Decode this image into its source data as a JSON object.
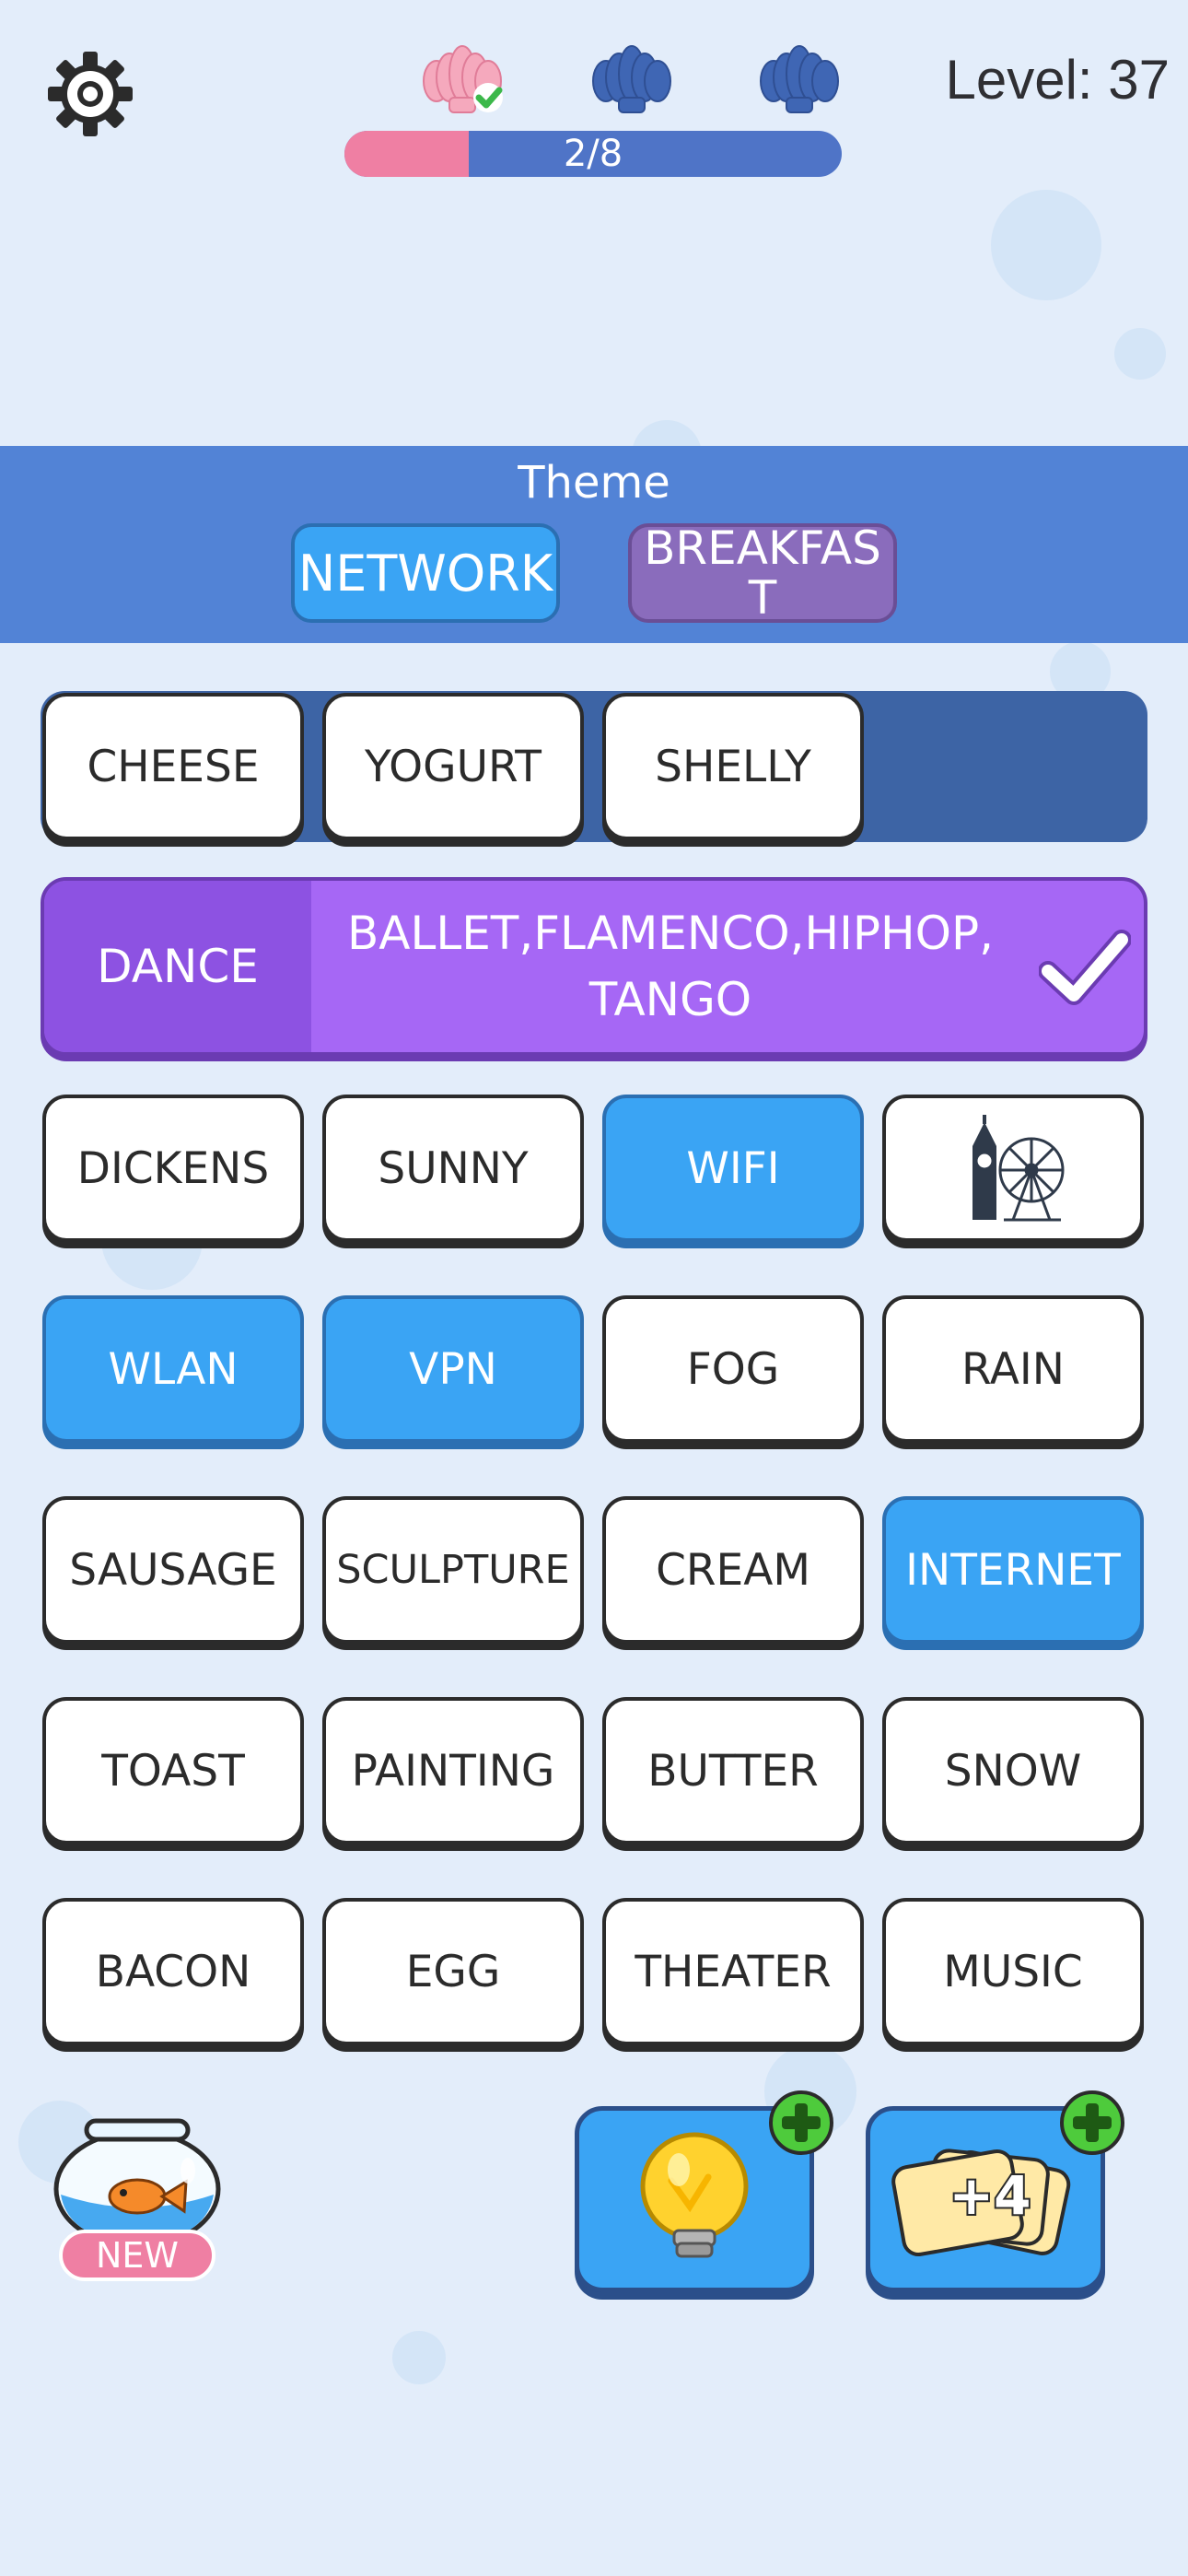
{
  "level": {
    "text": "Level: 37"
  },
  "progress": {
    "text": "2/8",
    "value": 0.25
  },
  "shells": {
    "completed": 1,
    "total": 3
  },
  "theme": {
    "title": "Theme",
    "options": [
      {
        "label": "NETWORK",
        "color": "#3aa4f4"
      },
      {
        "label": "BREAKFAST",
        "color": "#8a6cbc"
      }
    ]
  },
  "slot_row": {
    "words": [
      "CHEESE",
      "YOGURT",
      "SHELLY"
    ]
  },
  "solved": {
    "category": "DANCE",
    "words": "BALLET,FLAMENCO,HIPHOP,\nTANGO",
    "color": "#a667f5"
  },
  "grid": [
    [
      {
        "label": "DICKENS"
      },
      {
        "label": "SUNNY"
      },
      {
        "label": "WIFI",
        "selected": true
      },
      {
        "icon": "big-ben-ferris-wheel-icon"
      }
    ],
    [
      {
        "label": "WLAN",
        "selected": true
      },
      {
        "label": "VPN",
        "selected": true
      },
      {
        "label": "FOG"
      },
      {
        "label": "RAIN"
      }
    ],
    [
      {
        "label": "SAUSAGE"
      },
      {
        "label": "SCULPTURE"
      },
      {
        "label": "CREAM"
      },
      {
        "label": "INTERNET",
        "selected": true
      }
    ],
    [
      {
        "label": "TOAST"
      },
      {
        "label": "PAINTING"
      },
      {
        "label": "BUTTER"
      },
      {
        "label": "SNOW"
      }
    ],
    [
      {
        "label": "BACON"
      },
      {
        "label": "EGG"
      },
      {
        "label": "THEATER"
      },
      {
        "label": "MUSIC"
      }
    ]
  ],
  "bottom": {
    "new_badge": "NEW",
    "shuffle_label": "+4"
  },
  "colors": {
    "background": "#e3edfa",
    "selected": "#3aa4f4",
    "theme_band": "#5283d6"
  }
}
